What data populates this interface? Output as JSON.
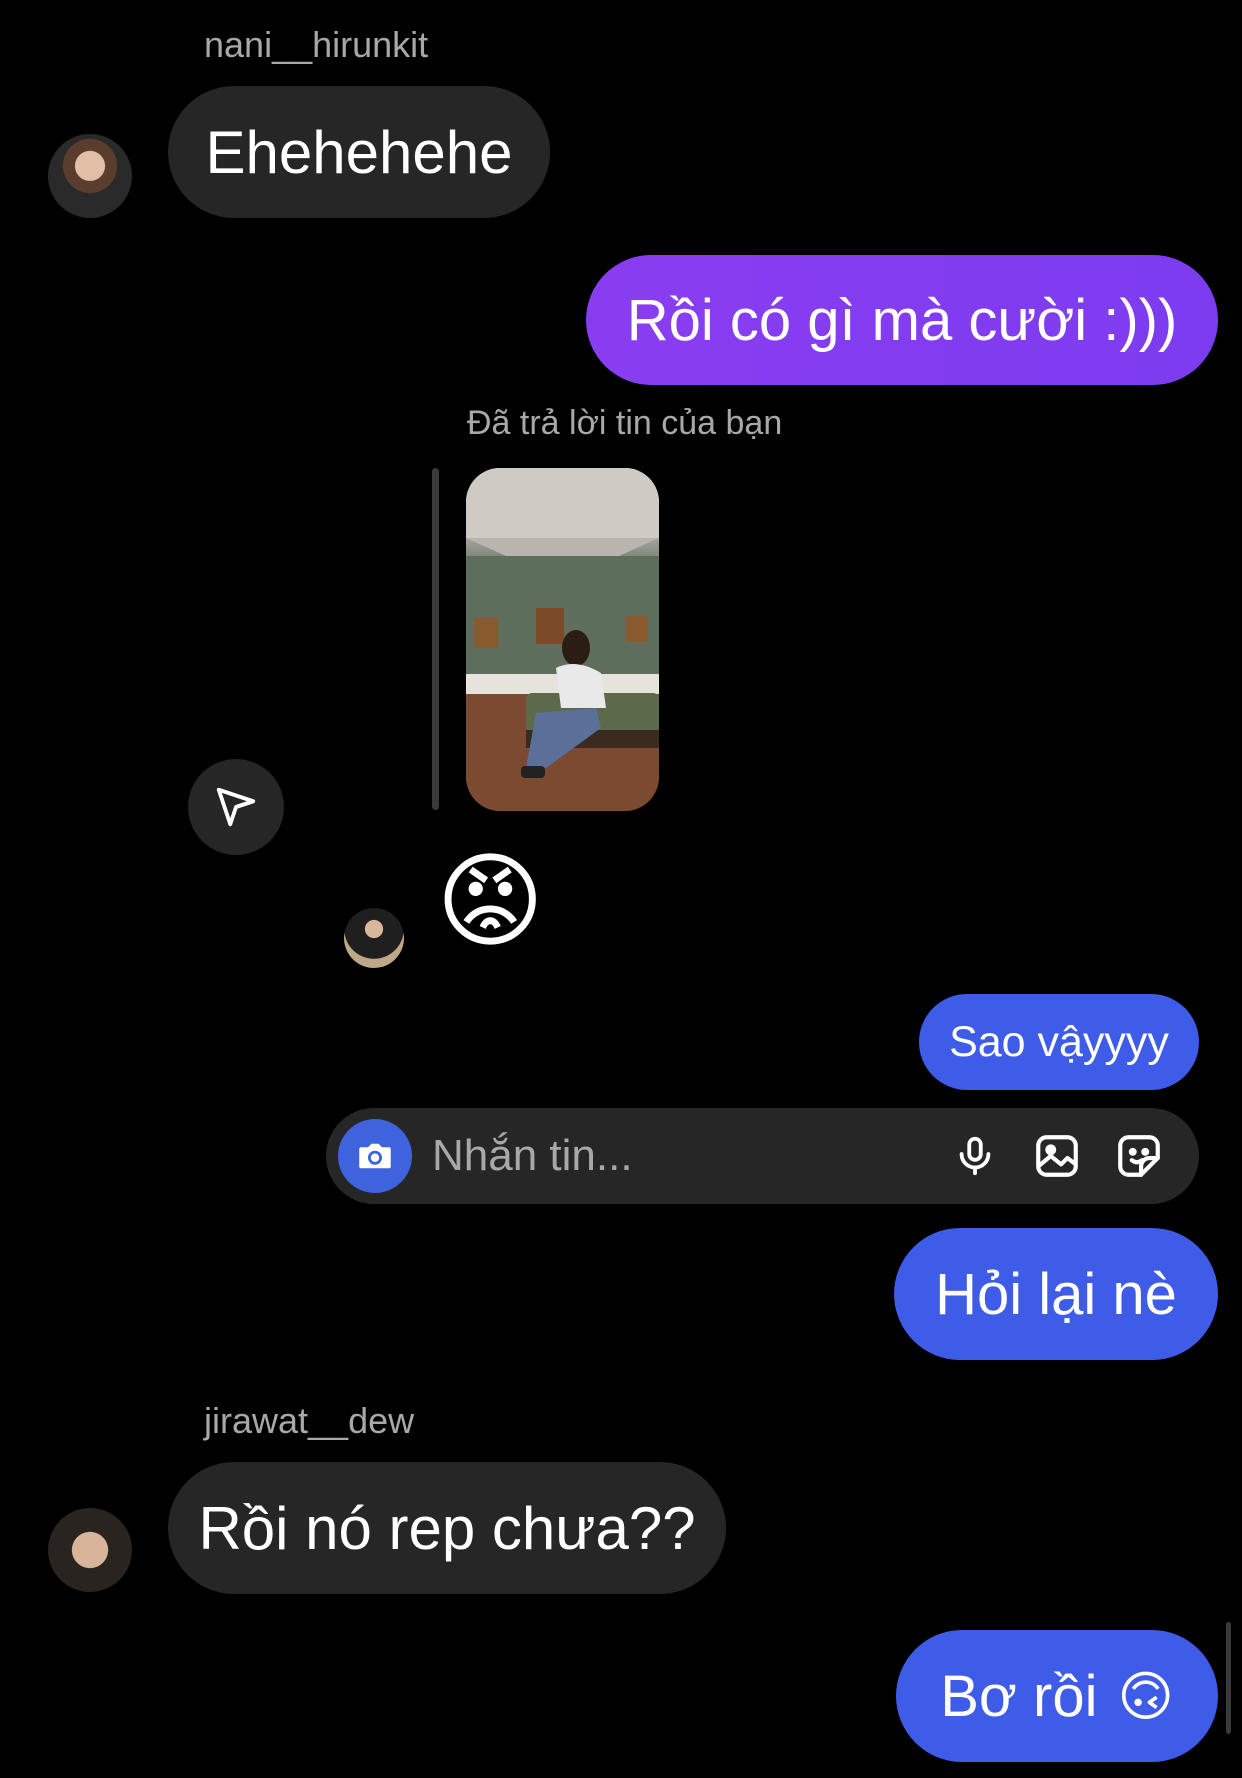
{
  "messages": {
    "m1": {
      "sender": "nani__hirunkit",
      "text": "Ehehehehe"
    },
    "m2": {
      "text": "Rồi có gì mà cười :)))"
    },
    "m3": {
      "reply_label": "Đã trả lời tin của bạn",
      "reaction_emoji": "😡"
    },
    "m4": {
      "text": "Sao vậyyyy"
    },
    "m5": {
      "text": "Hỏi lại nè"
    },
    "m6": {
      "sender": "jirawat__dew",
      "text": "Rồi nó rep chưa??"
    },
    "m7": {
      "text": "Bơ rồi",
      "emoji": "🙃"
    }
  },
  "composer": {
    "placeholder": "Nhắn tin..."
  },
  "colors": {
    "background": "#000000",
    "incoming_bubble": "#262626",
    "outgoing_purple": "#7d3cf0",
    "outgoing_blue": "#3f5ce8",
    "camera_button": "#3e63dd",
    "secondary_text": "#a8a8a8"
  },
  "icons": {
    "share": "paper-plane-icon",
    "camera": "camera-icon",
    "mic": "microphone-icon",
    "gallery": "image-icon",
    "sticker": "sticker-icon"
  }
}
